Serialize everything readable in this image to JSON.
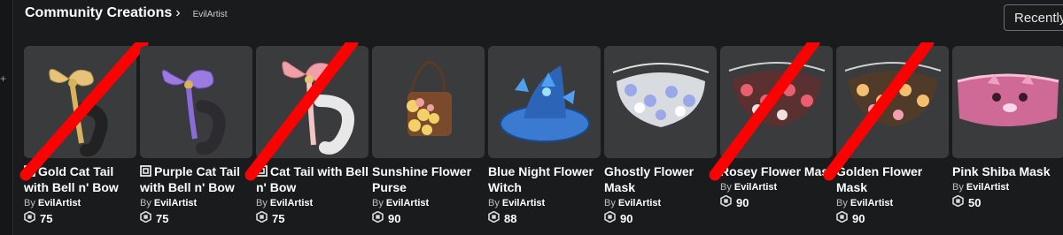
{
  "header": {
    "title": "Community Creations",
    "chevron": "›",
    "creator": "EvilArtist",
    "sort_label": "Recently"
  },
  "by_label": "By",
  "items": [
    {
      "name": "Gold Cat Tail with Bell n' Bow",
      "creator": "EvilArtist",
      "price": "75",
      "limited": true,
      "crossed": true,
      "thumb": "gold-cat-tail"
    },
    {
      "name": "Purple Cat Tail with Bell n' Bow",
      "creator": "EvilArtist",
      "price": "75",
      "limited": true,
      "crossed": false,
      "thumb": "purple-cat-tail"
    },
    {
      "name": "Cat Tail with Bell n' Bow",
      "creator": "EvilArtist",
      "price": "75",
      "limited": true,
      "crossed": true,
      "thumb": "pink-cat-tail"
    },
    {
      "name": "Sunshine Flower Purse",
      "creator": "EvilArtist",
      "price": "90",
      "limited": false,
      "crossed": false,
      "thumb": "flower-purse"
    },
    {
      "name": "Blue Night Flower Witch",
      "creator": "EvilArtist",
      "price": "88",
      "limited": false,
      "crossed": false,
      "thumb": "witch-hat"
    },
    {
      "name": "Ghostly Flower Mask",
      "creator": "EvilArtist",
      "price": "90",
      "limited": false,
      "crossed": false,
      "thumb": "ghostly-mask"
    },
    {
      "name": "Rosey Flower Mask",
      "creator": "EvilArtist",
      "price": "90",
      "limited": false,
      "crossed": true,
      "thumb": "rosey-mask"
    },
    {
      "name": "Golden Flower Mask",
      "creator": "EvilArtist",
      "price": "90",
      "limited": false,
      "crossed": true,
      "thumb": "golden-mask"
    },
    {
      "name": "Pink Shiba Mask",
      "creator": "EvilArtist",
      "price": "50",
      "limited": false,
      "crossed": false,
      "thumb": "shiba-mask"
    }
  ],
  "colors": {
    "background": "#191b1d",
    "card": "#393b3d",
    "strike": "#ff0000"
  }
}
